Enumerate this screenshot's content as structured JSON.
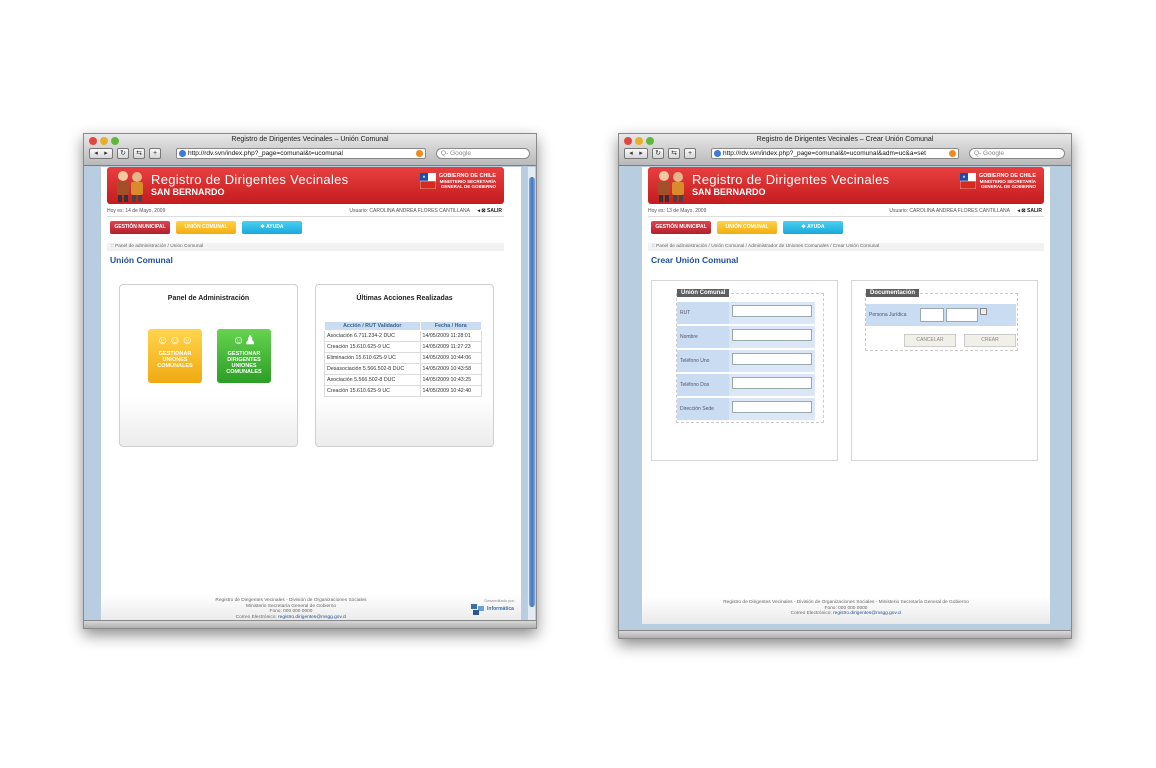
{
  "window1": {
    "title": "Registro de Dirigentes Vecinales – Unión Comunal",
    "url": "http://rdv.svn/index.php?_page=comunal&t=ucomunal",
    "search_placeholder": "Google",
    "banner": {
      "title": "Registro de Dirigentes Vecinales",
      "subtitle": "SAN BERNARDO",
      "gov_line1": "GOBIERNO DE CHILE",
      "gov_line2": "MINISTERIO SECRETARÍA",
      "gov_line3": "GENERAL DE GOBIERNO"
    },
    "date": "Hoy es: 14 de Mayo, 2009",
    "user": "Usuario: CAROLINA ANDREA FLORES CANTILLANA",
    "logout": "SALIR",
    "menu": {
      "gestion": "GESTIÓN MUNICIPAL",
      "union": "UNIÓN COMUNAL",
      "ayuda": "AYUDA"
    },
    "breadcrumb": ":: Panel de administración /  Unión Comunal",
    "page_title": "Unión Comunal",
    "admin_panel": {
      "title": "Panel de Administración",
      "tile1": "GESTIONAR UNIONES COMUNALES",
      "tile2": "GESTIONAR DIRIGENTES UNIONES COMUNALES"
    },
    "actions_panel": {
      "title": "Últimas Acciones Realizadas",
      "columns": [
        "Acción / RUT Validador",
        "Fecha / Hora"
      ],
      "rows": [
        [
          "Asociación 6.711.234-2 DUC",
          "14/05/2009 11:28:01"
        ],
        [
          "Creación 15.610.625-9 UC",
          "14/05/2009 11:27:23"
        ],
        [
          "Eliminación 15.610.625-9 UC",
          "14/05/2009 10:44:06"
        ],
        [
          "Desasociación 5.566.502-8 DUC",
          "14/05/2009 10:43:58"
        ],
        [
          "Asociación 5.566.502-8 DUC",
          "14/05/2009 10:43:25"
        ],
        [
          "Creación 15.610.625-9 UC",
          "14/05/2009 10:42:40"
        ]
      ]
    },
    "footer": {
      "line1": "Registro de Dirigentes Vecinales - División de Organizaciones Sociales",
      "line2": "Ministerio Secretaría General de Gobierno",
      "line3": "Fono: 000 000 0000",
      "line4_label": "Correo Electrónico:",
      "email": "registro.dirigentes@msgg.gov.cl",
      "dev_label": "Desarrollado por:",
      "dev_name": "Informática"
    }
  },
  "window2": {
    "title": "Registro de Dirigentes Vecinales – Crear Unión Comunal",
    "url": "http://rdv.svn/index.php?_page=comunal&t=ucomunal&adm=uc&a=set",
    "search_placeholder": "Google",
    "banner": {
      "title": "Registro de Dirigentes Vecinales",
      "subtitle": "SAN BERNARDO",
      "gov_line1": "GOBIERNO DE CHILE",
      "gov_line2": "MINISTERIO SECRETARÍA",
      "gov_line3": "GENERAL DE GOBIERNO"
    },
    "date": "Hoy es: 13 de Mayo, 2009",
    "user": "Usuario: CAROLINA ANDREA FLORES CANTILLANA",
    "logout": "SALIR",
    "menu": {
      "gestion": "GESTIÓN MUNICIPAL",
      "union": "UNIÓN COMUNAL",
      "ayuda": "AYUDA"
    },
    "breadcrumb": ":: Panel de administración /  Unión Comunal /  Administrador de Uniones Comunales /  Crear Unión Comunal",
    "page_title": "Crear Unión Comunal",
    "form": {
      "legend": "Unión Comunal",
      "fields": [
        "RUT",
        "Nombre",
        "Teléfono Uno",
        "Teléfono Dos",
        "Dirección Sede"
      ]
    },
    "doc": {
      "legend": "Documentación",
      "field": "Persona Jurídica",
      "cancel": "CANCELAR",
      "create": "CREAR"
    },
    "footer": {
      "line1": "Registro de Dirigentes Vecinales - División de Organizaciones Sociales - Ministerio Secretaría General de Gobierno",
      "line2": "Fono: 000 000 0000",
      "line3_label": "Correo Electrónico:",
      "email": "registro.dirigentes@msgg.gov.cl"
    }
  }
}
